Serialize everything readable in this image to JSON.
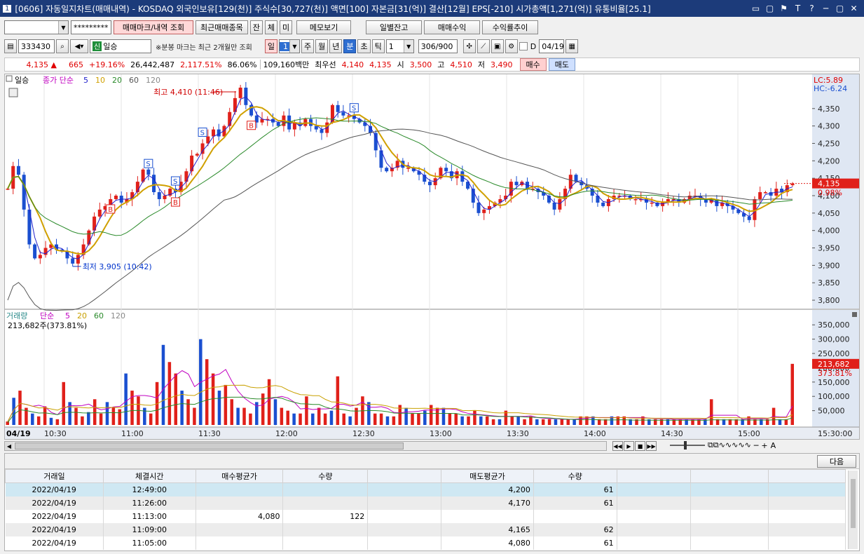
{
  "window": {
    "screen_id": "0606",
    "title": "자동일지차트(매매내역) - KOSDAQ 외국인보유[129(천)] 주식수[30,727(천)] 액면[100] 자본금[31(억)] 결산[12월] EPS[-210] 시가총액[1,271(억)] 유통비율[25.1]",
    "controls": [
      "▭",
      "▢",
      "⚑",
      "T",
      "?",
      "─",
      "▢",
      "✕"
    ]
  },
  "toolbar": {
    "account_value": "",
    "password_mask": "*********",
    "buttons": {
      "trade_mark": "매매마크/내역 조회",
      "recent_items": "최근매매종목",
      "jan": "잔",
      "che": "체",
      "mi": "미",
      "memo": "메모보기",
      "daily_balance": "일별잔고",
      "trade_profit": "매매수익",
      "return_trend": "수익률추이"
    }
  },
  "toolbar2": {
    "stock_code": "333430",
    "new_tag": "신",
    "stock_name": "일승",
    "note": "※분봉 마크는 최근 2개월만 조회",
    "period": {
      "day": "일",
      "num": "1",
      "week": "주",
      "month": "월",
      "year": "년",
      "minute": "분",
      "second": "초",
      "tick": "틱"
    },
    "tick_count": "1",
    "page_count": "306/900",
    "date_label": "D",
    "date_value": "04/19"
  },
  "pricebar": {
    "price": "4,135",
    "change_arrow": "▲",
    "change": "665",
    "change_pct": "+19.16%",
    "volume": "26,442,487",
    "vol_ratio": "2,117.51%",
    "ratio2": "86.06%",
    "amount": "109,160백만",
    "best_ask_label": "최우선",
    "best_ask": "4,140",
    "best_bid": "4,135",
    "open_label": "시",
    "open": "3,500",
    "high_label": "고",
    "high": "4,510",
    "low_label": "저",
    "low": "3,490",
    "buy_button": "매수",
    "sell_button": "매도"
  },
  "chart": {
    "price_header": {
      "period": "일승",
      "title": "종가 단순",
      "ma": [
        "5",
        "10",
        "20",
        "60",
        "120"
      ]
    },
    "volume_header": {
      "title": "거래량 단순",
      "ma": [
        "5",
        "20",
        "60",
        "120"
      ],
      "current": "213,682주(373.81%)"
    },
    "lc": "LC:5.89",
    "hc": "HC:-6.24",
    "high_label": "최고 4,410 (11:46)",
    "low_label": "최저 3,905 (10:42)",
    "current_price_tag": "4,135",
    "current_pct_tag": "0.98%",
    "current_vol_tag": "213,682",
    "current_vol_pct": "373.81%",
    "date_tag": "04/19",
    "price_ticks": [
      "4,350",
      "4,300",
      "4,250",
      "4,200",
      "4,150",
      "4,100",
      "4,050",
      "4,000",
      "3,950",
      "3,900",
      "3,850",
      "3,800"
    ],
    "vol_ticks": [
      "350,000",
      "300,000",
      "250,000",
      "200,000",
      "150,000",
      "100,000",
      "50,000"
    ],
    "time_ticks": [
      "10:30",
      "11:00",
      "11:30",
      "12:00",
      "12:30",
      "13:00",
      "13:30",
      "14:00",
      "14:30",
      "15:00"
    ],
    "end_time": "15:30:00",
    "marks": {
      "sell": "S",
      "buy": "B"
    }
  },
  "chart_data": {
    "type": "candlestick",
    "x_labels": [
      "10:30",
      "11:00",
      "11:30",
      "12:00",
      "12:30",
      "13:00",
      "13:30",
      "14:00",
      "14:30",
      "15:00"
    ],
    "price_range": [
      3780,
      4420
    ],
    "volume_range": [
      0,
      380000
    ],
    "close_path": [
      4120,
      4185,
      4160,
      4060,
      3960,
      3920,
      3930,
      3950,
      3960,
      3945,
      3940,
      3920,
      3905,
      3930,
      3960,
      4000,
      4040,
      4060,
      4070,
      4090,
      4100,
      4080,
      4090,
      4110,
      4140,
      4175,
      4160,
      4110,
      4090,
      4100,
      4120,
      4110,
      4140,
      4170,
      4215,
      4220,
      4250,
      4270,
      4290,
      4270,
      4300,
      4340,
      4380,
      4410,
      4360,
      4330,
      4310,
      4320,
      4320,
      4310,
      4300,
      4330,
      4290,
      4310,
      4300,
      4320,
      4300,
      4290,
      4280,
      4310,
      4360,
      4340,
      4330,
      4330,
      4320,
      4310,
      4300,
      4280,
      4230,
      4180,
      4170,
      4180,
      4200,
      4180,
      4180,
      4170,
      4160,
      4140,
      4130,
      4150,
      4180,
      4170,
      4150,
      4170,
      4140,
      4120,
      4080,
      4050,
      4060,
      4070,
      4080,
      4090,
      4100,
      4140,
      4130,
      4140,
      4120,
      4120,
      4110,
      4100,
      4080,
      4060,
      4090,
      4120,
      4160,
      4140,
      4130,
      4120,
      4100,
      4080,
      4070,
      4090,
      4100,
      4100,
      4100,
      4090,
      4090,
      4090,
      4080,
      4080,
      4070,
      4080,
      4090,
      4090,
      4080,
      4090,
      4100,
      4100,
      4090,
      4080,
      4090,
      4070,
      4080,
      4070,
      4060,
      4050,
      4040,
      4030,
      4090,
      4110,
      4110,
      4100,
      4120,
      4110,
      4130,
      4135
    ],
    "volume": [
      12000,
      95000,
      120000,
      60000,
      40000,
      30000,
      65000,
      25000,
      20000,
      150000,
      80000,
      60000,
      30000,
      45000,
      90000,
      40000,
      80000,
      60000,
      55000,
      180000,
      120000,
      100000,
      60000,
      40000,
      150000,
      280000,
      220000,
      180000,
      120000,
      90000,
      60000,
      300000,
      230000,
      180000,
      120000,
      140000,
      90000,
      60000,
      60000,
      40000,
      80000,
      110000,
      160000,
      90000,
      60000,
      50000,
      40000,
      40000,
      100000,
      40000,
      60000,
      40000,
      50000,
      170000,
      40000,
      30000,
      60000,
      100000,
      80000,
      40000,
      40000,
      30000,
      30000,
      70000,
      60000,
      40000,
      40000,
      50000,
      70000,
      60000,
      60000,
      40000,
      40000,
      30000,
      30000,
      50000,
      30000,
      30000,
      20000,
      20000,
      50000,
      30000,
      30000,
      20000,
      30000,
      20000,
      20000,
      20000,
      20000,
      20000,
      20000,
      20000,
      30000,
      30000,
      30000,
      20000,
      20000,
      30000,
      30000,
      30000,
      20000,
      20000,
      30000,
      20000,
      20000,
      20000,
      20000,
      20000,
      20000,
      20000,
      20000,
      20000,
      20000,
      90000,
      20000,
      20000,
      20000,
      20000,
      20000,
      30000,
      20000,
      20000,
      20000,
      60000,
      20000,
      20000,
      213682
    ]
  },
  "trades": {
    "next_button": "다음",
    "headers": [
      "거래일",
      "체결시간",
      "매수평균가",
      "수량",
      "",
      "매도평균가",
      "수량",
      "",
      "",
      ""
    ],
    "rows": [
      [
        "2022/04/19",
        "12:49:00",
        "",
        "",
        "",
        "4,200",
        "61",
        "",
        "",
        ""
      ],
      [
        "2022/04/19",
        "11:26:00",
        "",
        "",
        "",
        "4,170",
        "61",
        "",
        "",
        ""
      ],
      [
        "2022/04/19",
        "11:13:00",
        "4,080",
        "122",
        "",
        "",
        "",
        "",
        "",
        ""
      ],
      [
        "2022/04/19",
        "11:09:00",
        "",
        "",
        "",
        "4,165",
        "62",
        "",
        "",
        ""
      ],
      [
        "2022/04/19",
        "11:05:00",
        "",
        "",
        "",
        "4,080",
        "61",
        "",
        "",
        ""
      ]
    ]
  }
}
